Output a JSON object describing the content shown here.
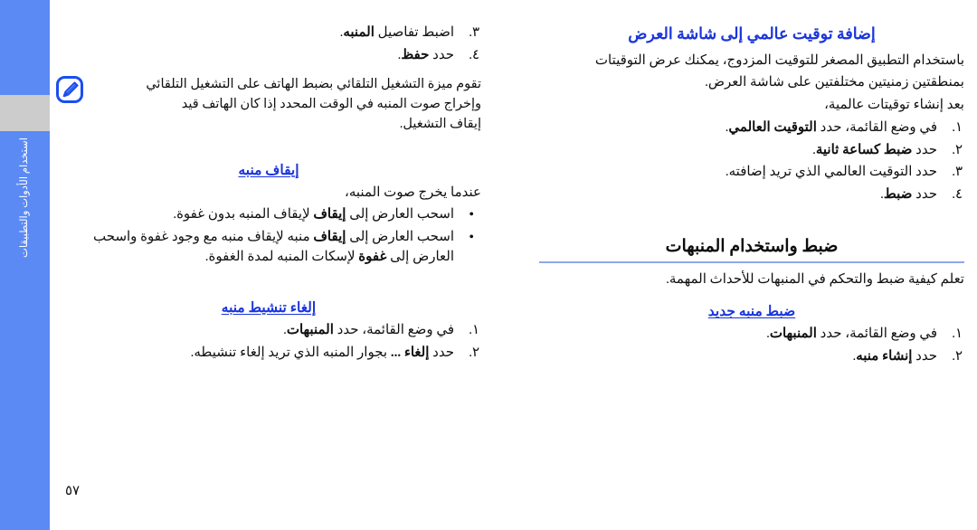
{
  "page": {
    "number": "٥٧",
    "tab_label": "استخدام الأدوات والتطبيقات",
    "colors": {
      "tab_blue": "#5b8af5",
      "tab_gray": "#cccccc",
      "heading_blue": "#1a35dd",
      "rule_blue": "#8fa8e8",
      "text_black": "#101010"
    }
  },
  "left_column": {
    "continued_steps": [
      {
        "marker": "٣.",
        "text_before": "اضبط تفاصيل ",
        "bold": "المنبه",
        "text_after": "."
      },
      {
        "marker": "٤.",
        "text_before": "حدد ",
        "bold": "حفظ",
        "text_after": "."
      }
    ],
    "note": {
      "icon": "note-pencil-icon",
      "lines": [
        "تقوم ميزة التشغيل التلقائي بضبط الهاتف على التشغيل التلقائي",
        "وإخراج صوت المنبه في الوقت المحدد إذا كان الهاتف قيد",
        "إيقاف التشغيل."
      ]
    },
    "stop_alarm": {
      "heading": "إيقاف منبه",
      "intro": "عندما يخرج صوت المنبه،",
      "bullets": [
        {
          "marker": "•",
          "parts": [
            "اسحب العارض إلى ",
            "إيقاف",
            " لإيقاف المنبه بدون غفوة."
          ]
        },
        {
          "marker": "•",
          "parts": [
            "اسحب العارض إلى ",
            "إيقاف",
            " منبه لإيقاف منبه مع وجود غفوة واسحب العارض إلى ",
            "غفوة",
            " لإسكات المنبه لمدة الغفوة."
          ]
        }
      ]
    },
    "deactivate_alarm": {
      "heading": "إلغاء تنشيط منبه",
      "steps": [
        {
          "marker": "١.",
          "text_before": "في وضع القائمة، حدد ",
          "bold": "المنبهات",
          "text_after": "."
        },
        {
          "marker": "٢.",
          "text_before": "حدد ",
          "bold": "إلغاء ...",
          "text_after": " بجوار المنبه الذي تريد إلغاء تنشيطه."
        }
      ]
    }
  },
  "right_column": {
    "world_clock": {
      "heading": "إضافة توقيت عالمي إلى شاشة العرض",
      "paragraph_lines": [
        "باستخدام التطبيق المصغر للتوقيت المزدوج، يمكنك عرض التوقيتات",
        "بمنطقتين زمنيتين مختلفتين على شاشة العرض."
      ],
      "after_text": "بعد إنشاء توقيتات عالمية،",
      "steps": [
        {
          "marker": "١.",
          "text_before": "في وضع القائمة، حدد ",
          "bold": "التوقيت العالمي",
          "text_after": "."
        },
        {
          "marker": "٢.",
          "text_before": "حدد ",
          "bold": "ضبط كساعة ثانية",
          "text_after": "."
        },
        {
          "marker": "٣.",
          "text_before": "حدد التوقيت العالمي الذي تريد إضافته",
          "bold": "",
          "text_after": "."
        },
        {
          "marker": "٤.",
          "text_before": "حدد ",
          "bold": "ضبط",
          "text_after": "."
        }
      ]
    },
    "alarms_section": {
      "heading": "ضبط واستخدام المنبهات",
      "intro": "تعلم كيفية ضبط والتحكم في المنبهات للأحداث المهمة.",
      "new_alarm": {
        "heading": "ضبط منبه جديد",
        "steps": [
          {
            "marker": "١.",
            "text_before": "في وضع القائمة، حدد ",
            "bold": "المنبهات",
            "text_after": "."
          },
          {
            "marker": "٢.",
            "text_before": "حدد ",
            "bold": "إنشاء منبه",
            "text_after": "."
          }
        ]
      }
    }
  }
}
